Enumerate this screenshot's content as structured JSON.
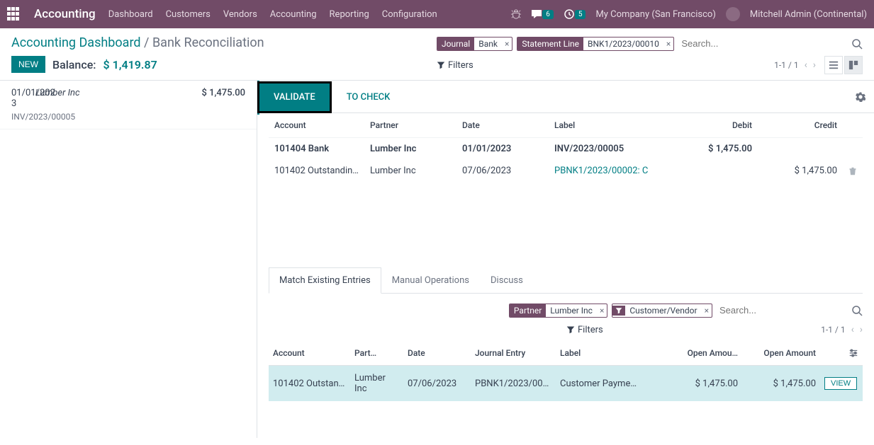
{
  "topnav": {
    "brand": "Accounting",
    "links": [
      "Dashboard",
      "Customers",
      "Vendors",
      "Accounting",
      "Reporting",
      "Configuration"
    ],
    "messages_count": "6",
    "activities_count": "5",
    "company": "My Company (San Francisco)",
    "user": "Mitchell Admin (Continental)"
  },
  "breadcrumb": {
    "root": "Accounting Dashboard",
    "current": "Bank Reconciliation"
  },
  "new_label": "NEW",
  "balance": {
    "label": "Balance:",
    "value": "$ 1,419.87"
  },
  "search": {
    "facets": [
      {
        "key": "Journal",
        "val": "Bank"
      },
      {
        "key": "Statement Line",
        "val": "BNK1/2023/00010"
      }
    ],
    "placeholder": "Search...",
    "filters_label": "Filters",
    "pager": "1-1 / 1"
  },
  "statement": {
    "date": "01/01/2023",
    "partner": "Lumber Inc",
    "amount": "$ 1,475.00",
    "ref": "INV/2023/00005"
  },
  "tabs": {
    "validate": "VALIDATE",
    "tocheck": "TO CHECK"
  },
  "recon": {
    "headers": {
      "account": "Account",
      "partner": "Partner",
      "date": "Date",
      "label": "Label",
      "debit": "Debit",
      "credit": "Credit"
    },
    "main": {
      "account": "101404 Bank",
      "partner": "Lumber Inc",
      "date": "01/01/2023",
      "label": "INV/2023/00005",
      "debit": "$ 1,475.00",
      "credit": ""
    },
    "match": {
      "account": "101402 Outstandin…",
      "partner": "Lumber Inc",
      "date": "07/06/2023",
      "label": "PBNK1/2023/00002: C",
      "debit": "",
      "credit": "$ 1,475.00"
    }
  },
  "subtabs": {
    "match": "Match Existing Entries",
    "manual": "Manual Operations",
    "discuss": "Discuss"
  },
  "subsearch": {
    "facets": [
      {
        "key": "Partner",
        "val": "Lumber Inc"
      },
      {
        "key_icon": "filter",
        "val": "Customer/Vendor"
      }
    ],
    "placeholder": "Search...",
    "filters_label": "Filters",
    "pager": "1-1 / 1"
  },
  "matchtable": {
    "headers": {
      "account": "Account",
      "partner": "Part…",
      "date": "Date",
      "journal": "Journal Entry",
      "label": "Label",
      "open_cur": "Open Amou…",
      "open": "Open Amount"
    },
    "row": {
      "account": "101402 Outstan…",
      "partner": "Lumber Inc",
      "date": "07/06/2023",
      "journal": "PBNK1/2023/00…",
      "label": "Customer Payme…",
      "open_cur": "$ 1,475.00",
      "open": "$ 1,475.00",
      "view": "VIEW"
    }
  }
}
